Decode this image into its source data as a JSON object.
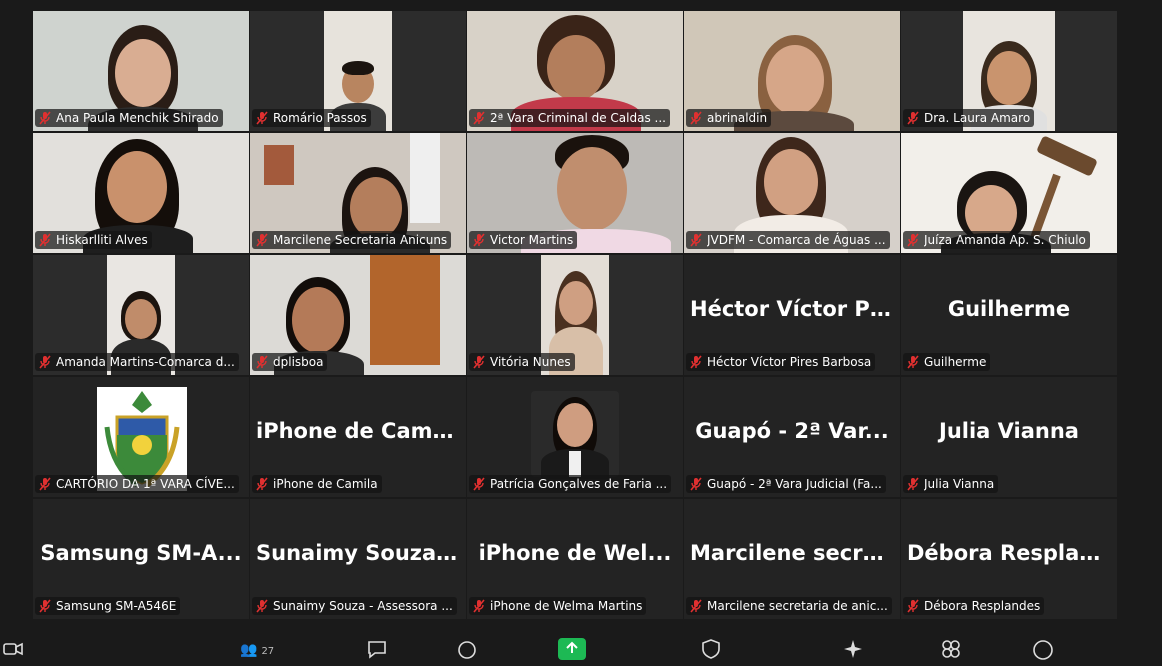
{
  "participants": [
    {
      "label": "Ana Paula Menchik Shirado"
    },
    {
      "label": "Romário Passos"
    },
    {
      "label": "2ª Vara Criminal de Caldas ..."
    },
    {
      "label": "abrinaldin"
    },
    {
      "label": "Dra. Laura Amaro"
    },
    {
      "label": "Hiskarlliti Alves"
    },
    {
      "label": "Marcilene Secretaria Anicuns"
    },
    {
      "label": "Victor Martins"
    },
    {
      "label": "JVDFM - Comarca de Águas ..."
    },
    {
      "label": "Juíza Amanda Ap. S. Chiulo"
    },
    {
      "label": "Amanda Martins-Comarca d..."
    },
    {
      "label": "dplisboa"
    },
    {
      "label": "Vitória Nunes"
    },
    {
      "label": "Héctor Víctor Pires Barbosa",
      "display": "Héctor Víctor Pi..."
    },
    {
      "label": "Guilherme",
      "display": "Guilherme"
    },
    {
      "label": "CARTÓRIO DA 1ª VARA CÍVE..."
    },
    {
      "label": "iPhone de Camila",
      "display": "iPhone de Camila"
    },
    {
      "label": "Patrícia Gonçalves de Faria ..."
    },
    {
      "label": "Guapó - 2ª Vara Judicial (Fa...",
      "display": "Guapó - 2ª Var..."
    },
    {
      "label": "Julia Vianna",
      "display": "Julia Vianna"
    },
    {
      "label": "Samsung SM-A546E",
      "display": "Samsung SM-A..."
    },
    {
      "label": "Sunaimy Souza - Assessora ...",
      "display": "Sunaimy Souza..."
    },
    {
      "label": "iPhone de Welma Martins",
      "display": "iPhone de Wel..."
    },
    {
      "label": "Marcilene secretaria de anic...",
      "display": "Marcilene secre..."
    },
    {
      "label": "Débora Resplandes",
      "display": "Débora Resplan..."
    }
  ],
  "toolbar": {
    "participant_count": "27"
  },
  "colors": {
    "muted_mic": "#e03030",
    "background": "#1a1a1a",
    "tile": "#232323"
  }
}
